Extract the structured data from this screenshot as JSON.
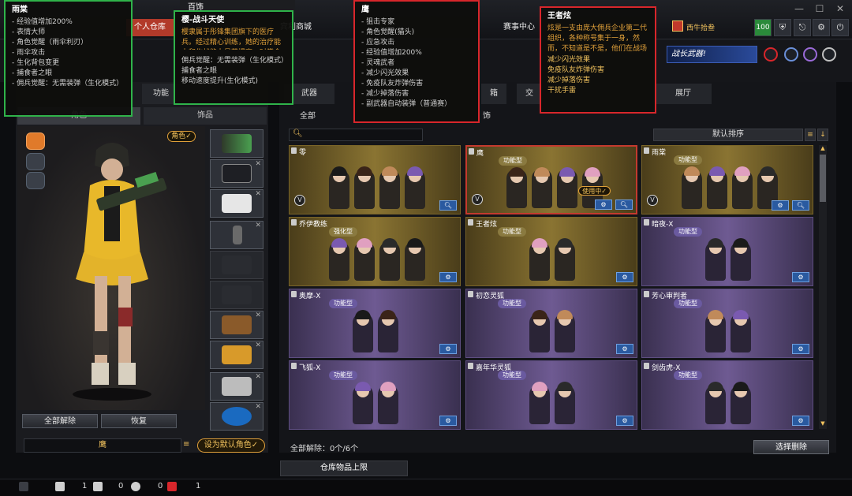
{
  "topbar": {
    "nav": [
      "个人仓库",
      "宾利商城",
      "赛事中心"
    ],
    "level": "100",
    "username": "西牛拾叁"
  },
  "subbar": {
    "banner_text": "战长武器!"
  },
  "left": {
    "tabs": [
      "功能"
    ],
    "subtabs": [
      "角色",
      "饰品"
    ],
    "role_tag": "角色✓",
    "unequip_all": "全部解除",
    "restore": "恢复",
    "character_name": "鹰",
    "set_default": "设为默认角色✓"
  },
  "right": {
    "tabs": [
      "武器",
      "箱",
      "交",
      "展厅"
    ],
    "filter_all": "全部",
    "filter_accessory": "饰",
    "sort_label": "默认排序",
    "cards": [
      {
        "name": "零",
        "tag": "",
        "style": "gold",
        "in_use": ""
      },
      {
        "name": "鹰",
        "tag": "功能型",
        "style": "gold",
        "in_use": "使用中✓"
      },
      {
        "name": "雨棠",
        "tag": "功能型",
        "style": "gold",
        "in_use": ""
      },
      {
        "name": "乔伊教练",
        "tag": "强化型",
        "style": "gold",
        "in_use": ""
      },
      {
        "name": "王者炫",
        "tag": "功能型",
        "style": "gold",
        "in_use": ""
      },
      {
        "name": "暗夜-X",
        "tag": "功能型",
        "style": "purple",
        "in_use": ""
      },
      {
        "name": "奥摩-X",
        "tag": "功能型",
        "style": "purple",
        "in_use": ""
      },
      {
        "name": "初恋灵狐",
        "tag": "功能型",
        "style": "purple",
        "in_use": ""
      },
      {
        "name": "芳心审判者",
        "tag": "功能型",
        "style": "purple",
        "in_use": ""
      },
      {
        "name": "飞狐-X",
        "tag": "功能型",
        "style": "purple",
        "in_use": ""
      },
      {
        "name": "嘉年华灵狐",
        "tag": "功能型",
        "style": "purple",
        "in_use": ""
      },
      {
        "name": "剑齿虎-X",
        "tag": "功能型",
        "style": "purple",
        "in_use": ""
      }
    ],
    "bottom_info": "全部解除：0个/6个",
    "select_delete": "选择删除",
    "capacity": "仓库物品上限"
  },
  "status": {
    "items": [
      "1",
      "0",
      "0",
      "1"
    ]
  },
  "tooltips": {
    "yutang": {
      "title": "雨棠",
      "items": [
        "经验值增加200%",
        "表情大师",
        "角色觉醒（雨伞利刃）",
        "雨伞攻击",
        "生化背包变更",
        "捕食者之眼",
        "佣兵觉醒：无需装弹（生化模式）"
      ]
    },
    "ying_angel": {
      "header": "百饰",
      "title": "樱-战斗天使",
      "desc": "樱隶属于彤锋集团旗下的医疗兵。经过精心训练，她的治疗能力和作战能力显著提高，时常会身着",
      "items": [
        "佣兵觉醒：无需装弹（生化模式）",
        "捕食者之眼",
        "移动速度提升(生化模式)"
      ]
    },
    "ying": {
      "title": "鹰",
      "items": [
        "狙击专家",
        "角色觉醒(猫头)",
        "应急攻击",
        "经验值增加200%",
        "灵魂武者",
        "减少闪光效果",
        "免疫队友炸弹伤害",
        "减少掉落伤害",
        "副武器自动装弹（普通赛）"
      ]
    },
    "wangzhexuan": {
      "title": "王者炫",
      "desc": "炫是一支由庞大佣兵企业第二代组织，各种称号集于一身，然而，不知道是不是，他们在战场上也表现得很锐利。",
      "items": [
        "减少闪光效果",
        "免疫队友炸弹伤害",
        "减少掉落伤害",
        "干扰手雷"
      ]
    }
  }
}
